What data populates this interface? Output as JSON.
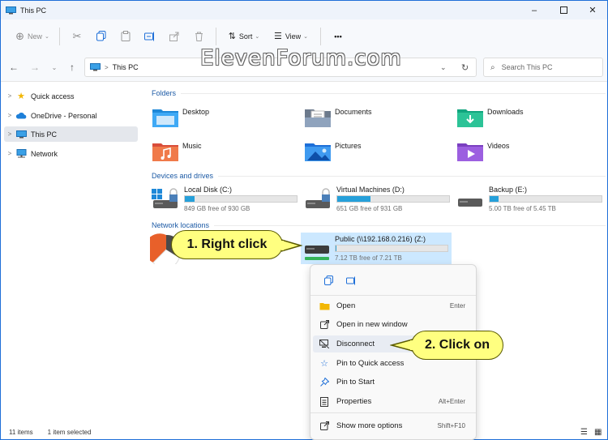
{
  "window": {
    "title": "This PC"
  },
  "toolbar": {
    "new_label": "New",
    "sort_label": "Sort",
    "view_label": "View",
    "more_label": "•••"
  },
  "address": {
    "path": "This PC"
  },
  "search": {
    "placeholder": "Search This PC"
  },
  "sidebar": {
    "items": [
      {
        "label": "Quick access"
      },
      {
        "label": "OneDrive - Personal"
      },
      {
        "label": "This PC"
      },
      {
        "label": "Network"
      }
    ]
  },
  "groups": {
    "folders": "Folders",
    "drives": "Devices and drives",
    "network": "Network locations"
  },
  "folders": [
    {
      "name": "Desktop"
    },
    {
      "name": "Documents"
    },
    {
      "name": "Downloads"
    },
    {
      "name": "Music"
    },
    {
      "name": "Pictures"
    },
    {
      "name": "Videos"
    }
  ],
  "drives": [
    {
      "name": "Local Disk (C:)",
      "free": "849 GB free of 930 GB",
      "used_fraction": 0.09
    },
    {
      "name": "Virtual Machines (D:)",
      "free": "651 GB free of 931 GB",
      "used_fraction": 0.3
    },
    {
      "name": "Backup (E:)",
      "free": "5.00 TB free of 5.45 TB",
      "used_fraction": 0.08
    }
  ],
  "network_drive": {
    "name": "Public (\\\\192.168.0.216) (Z:)",
    "free": "7.12 TB free of 7.21 TB",
    "used_fraction": 0.01
  },
  "context_menu": {
    "items": [
      {
        "label": "Open",
        "shortcut": "Enter"
      },
      {
        "label": "Open in new window",
        "shortcut": ""
      },
      {
        "label": "Disconnect",
        "shortcut": ""
      },
      {
        "label": "Pin to Quick access",
        "shortcut": ""
      },
      {
        "label": "Pin to Start",
        "shortcut": ""
      },
      {
        "label": "Properties",
        "shortcut": "Alt+Enter"
      },
      {
        "label": "Show more options",
        "shortcut": "Shift+F10"
      }
    ]
  },
  "callouts": {
    "first": "1. Right click",
    "second": "2. Click on"
  },
  "watermark": "ElevenForum.com",
  "status": {
    "items": "11 items",
    "selected": "1 item selected"
  },
  "colors": {
    "accent": "#1e6fd8",
    "drive_bar": "#26a0da",
    "callout": "#ffff80",
    "selection": "#cce8ff"
  }
}
